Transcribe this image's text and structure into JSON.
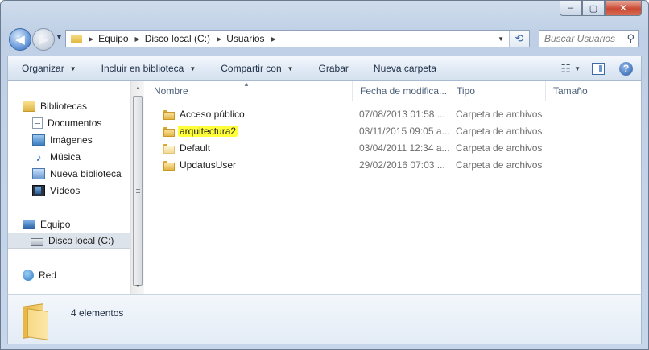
{
  "window": {
    "caption": {
      "minimize": "–",
      "maximize": "▢",
      "close": "✕"
    }
  },
  "nav": {
    "back_glyph": "◀",
    "forward_glyph": "▶",
    "breadcrumb": [
      "Equipo",
      "Disco local (C:)",
      "Usuarios"
    ],
    "search_placeholder": "Buscar Usuarios"
  },
  "toolbar": {
    "organize": "Organizar",
    "include_library": "Incluir en biblioteca",
    "share": "Compartir con",
    "burn": "Grabar",
    "new_folder": "Nueva carpeta",
    "help": "?"
  },
  "sidebar": {
    "libraries": "Bibliotecas",
    "library_items": [
      "Documentos",
      "Imágenes",
      "Música",
      "Nueva biblioteca",
      "Vídeos"
    ],
    "computer": "Equipo",
    "local_disk": "Disco local (C:)",
    "network": "Red"
  },
  "columns": {
    "name": "Nombre",
    "date": "Fecha de modifica...",
    "type": "Tipo",
    "size": "Tamaño"
  },
  "files": [
    {
      "name": "Acceso público",
      "date": "07/08/2013 01:58 ...",
      "type": "Carpeta de archivos"
    },
    {
      "name": "arquitectura2",
      "date": "03/11/2015 09:05 a...",
      "type": "Carpeta de archivos"
    },
    {
      "name": "Default",
      "date": "03/04/2011 12:34 a...",
      "type": "Carpeta de archivos"
    },
    {
      "name": "UpdatusUser",
      "date": "29/02/2016 07:03 ...",
      "type": "Carpeta de archivos"
    }
  ],
  "status": {
    "count": "4 elementos"
  },
  "colors": {
    "highlight": "#ffff3a",
    "selection": "#dde3ea",
    "chrome": "#bfd0e6"
  }
}
